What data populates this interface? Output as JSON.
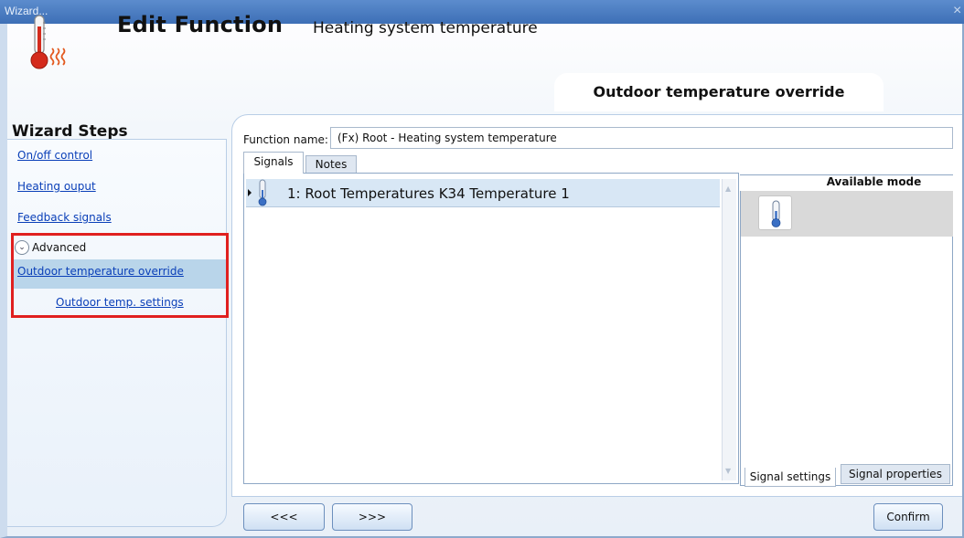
{
  "window": {
    "title": "Wizard...",
    "close_glyph": "×"
  },
  "header": {
    "title": "Edit Function",
    "subtitle": "Heating system temperature",
    "current_step": "Outdoor temperature override",
    "icon": "thermometer-heat-icon"
  },
  "sidebar": {
    "title": "Wizard Steps",
    "steps": [
      {
        "label": "On/off control"
      },
      {
        "label": "Heating ouput"
      },
      {
        "label": "Feedback signals"
      }
    ],
    "advanced": {
      "label": "Advanced",
      "expanded": true,
      "items": [
        {
          "label": "Outdoor temperature override",
          "selected": true
        },
        {
          "label": "Outdoor temp. settings",
          "selected": false
        }
      ]
    },
    "highlight_color": "#e0201f"
  },
  "form": {
    "function_name_label": "Function name:",
    "function_name_value": "(Fx) Root - Heating system temperature"
  },
  "tabs": [
    {
      "label": "Signals",
      "active": true
    },
    {
      "label": "Notes",
      "active": false
    }
  ],
  "signals": [
    {
      "label": "1: Root Temperatures K34 Temperature 1",
      "icon": "thermometer-icon"
    }
  ],
  "modes": {
    "header": "Available mode",
    "items": [
      {
        "icon": "thermometer-icon"
      }
    ]
  },
  "bottom_tabs": [
    {
      "label": "Signal settings",
      "active": true
    },
    {
      "label": "Signal properties",
      "active": false
    }
  ],
  "nav": {
    "prev_label": "<<<",
    "next_label": ">>>",
    "confirm_label": "Confirm"
  }
}
